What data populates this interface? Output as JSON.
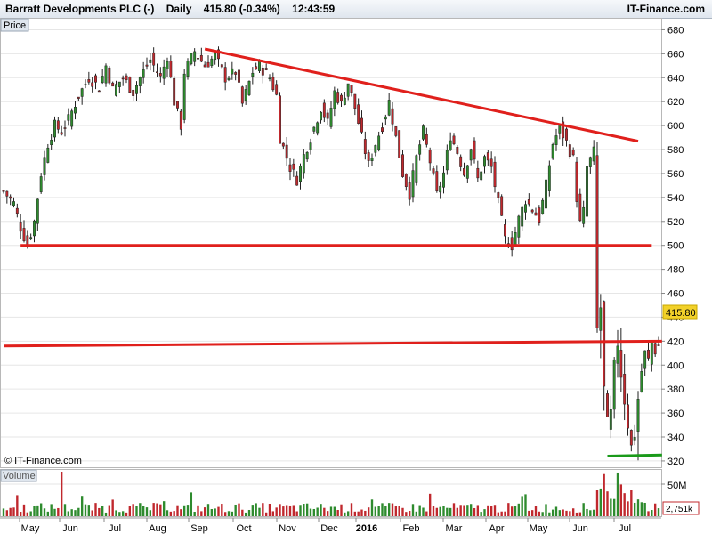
{
  "header": {
    "instrument": "Barratt Developments PLC (-)",
    "period": "Daily",
    "quote": "415.80 (-0.34%)",
    "time": "12:43:59",
    "brand": "IT-Finance.com"
  },
  "panels": {
    "price_label": "Price",
    "volume_label": "Volume",
    "watermark": "© IT-Finance.com"
  },
  "colors": {
    "up": "#2e8b2e",
    "down": "#c0282d",
    "trendline": "#e0201c",
    "support_line": "#1a9a1a",
    "last_price_bg": "#f2d12a"
  },
  "chart_data": {
    "type": "candlestick",
    "price_axis": {
      "ylim": [
        314,
        690
      ],
      "ticks": [
        320,
        340,
        360,
        380,
        400,
        420,
        440,
        460,
        480,
        500,
        520,
        540,
        560,
        580,
        600,
        620,
        640,
        660,
        680
      ]
    },
    "volume_axis": {
      "ticks": [
        "50M"
      ]
    },
    "x_labels": [
      "May",
      "Jun",
      "Jul",
      "Aug",
      "Sep",
      "Oct",
      "Nov",
      "Dec",
      "2016",
      "Feb",
      "Mar",
      "Apr",
      "May",
      "Jun",
      "Jul"
    ],
    "last_price": "415.80",
    "last_volume": "2,751k",
    "price_path": [
      [
        0,
        545
      ],
      [
        3,
        535
      ],
      [
        5,
        515
      ],
      [
        7,
        500
      ],
      [
        9,
        520
      ],
      [
        11,
        560
      ],
      [
        13,
        585
      ],
      [
        15,
        600
      ],
      [
        17,
        595
      ],
      [
        19,
        605
      ],
      [
        22,
        625
      ],
      [
        25,
        640
      ],
      [
        28,
        632
      ],
      [
        30,
        650
      ],
      [
        32,
        630
      ],
      [
        35,
        640
      ],
      [
        38,
        628
      ],
      [
        40,
        640
      ],
      [
        43,
        655
      ],
      [
        46,
        640
      ],
      [
        48,
        658
      ],
      [
        50,
        620
      ],
      [
        52,
        600
      ],
      [
        53,
        645
      ],
      [
        56,
        662
      ],
      [
        59,
        650
      ],
      [
        62,
        658
      ],
      [
        65,
        640
      ],
      [
        68,
        645
      ],
      [
        70,
        618
      ],
      [
        73,
        645
      ],
      [
        75,
        650
      ],
      [
        78,
        640
      ],
      [
        80,
        625
      ],
      [
        81,
        590
      ],
      [
        84,
        565
      ],
      [
        86,
        555
      ],
      [
        88,
        575
      ],
      [
        90,
        590
      ],
      [
        93,
        615
      ],
      [
        95,
        602
      ],
      [
        97,
        628
      ],
      [
        99,
        618
      ],
      [
        101,
        636
      ],
      [
        103,
        615
      ],
      [
        105,
        590
      ],
      [
        107,
        567
      ],
      [
        109,
        585
      ],
      [
        111,
        600
      ],
      [
        113,
        620
      ],
      [
        115,
        590
      ],
      [
        117,
        560
      ],
      [
        119,
        543
      ],
      [
        121,
        573
      ],
      [
        123,
        595
      ],
      [
        125,
        570
      ],
      [
        127,
        542
      ],
      [
        129,
        560
      ],
      [
        131,
        592
      ],
      [
        133,
        578
      ],
      [
        135,
        560
      ],
      [
        137,
        582
      ],
      [
        139,
        555
      ],
      [
        141,
        573
      ],
      [
        143,
        565
      ],
      [
        145,
        535
      ],
      [
        147,
        505
      ],
      [
        149,
        500
      ],
      [
        151,
        522
      ],
      [
        153,
        538
      ],
      [
        155,
        530
      ],
      [
        157,
        522
      ],
      [
        159,
        550
      ],
      [
        161,
        585
      ],
      [
        163,
        598
      ],
      [
        165,
        586
      ],
      [
        167,
        572
      ],
      [
        168,
        540
      ],
      [
        169,
        518
      ],
      [
        170,
        528
      ],
      [
        171,
        565
      ],
      [
        173,
        578
      ],
      [
        174,
        430
      ],
      [
        175,
        448
      ],
      [
        176,
        380
      ],
      [
        177,
        352
      ],
      [
        178,
        360
      ],
      [
        179,
        400
      ],
      [
        180,
        418
      ],
      [
        181,
        392
      ],
      [
        182,
        370
      ],
      [
        183,
        350
      ],
      [
        184,
        332
      ],
      [
        185,
        342
      ],
      [
        186,
        372
      ],
      [
        187,
        395
      ],
      [
        188,
        410
      ],
      [
        189,
        404
      ],
      [
        190,
        420
      ],
      [
        191,
        412
      ],
      [
        192,
        416
      ]
    ],
    "price_lines": [
      {
        "role": "resistance",
        "from": [
          59,
          664
        ],
        "to": [
          186,
          587
        ]
      },
      {
        "role": "support",
        "from": [
          5,
          500
        ],
        "to": [
          190,
          500
        ]
      },
      {
        "role": "resistance",
        "from": [
          0,
          416
        ],
        "to": [
          193,
          420
        ]
      },
      {
        "role": "support",
        "from": [
          177,
          324
        ],
        "to": [
          193,
          325
        ]
      }
    ]
  }
}
